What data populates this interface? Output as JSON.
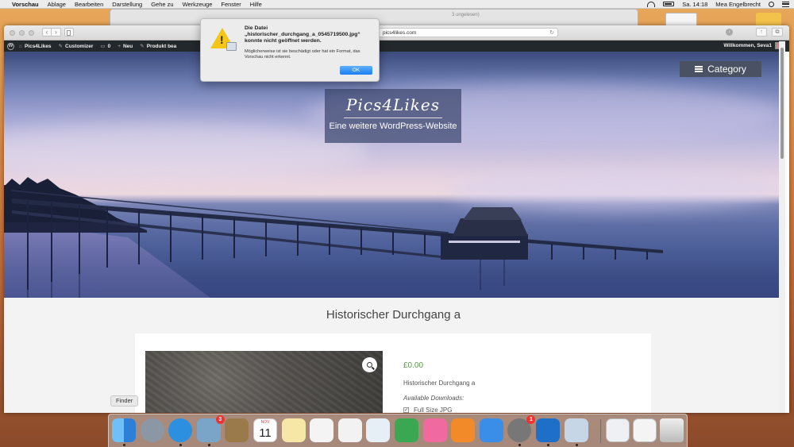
{
  "menubar": {
    "app_name": "Vorschau",
    "items": [
      "Ablage",
      "Bearbeiten",
      "Darstellung",
      "Gehe zu",
      "Werkzeuge",
      "Fenster",
      "Hilfe"
    ],
    "clock": "Sa. 14:18",
    "user": "Mea Engelbrecht"
  },
  "bg_window": {
    "title_fragment": "3 ungelesen)"
  },
  "safari": {
    "url": "pics4likes.com"
  },
  "wp_admin_bar": {
    "site_name": "Pics4Likes",
    "customizer": "Customizer",
    "comments_count": "0",
    "new_label": "Neu",
    "product_label": "Produkt bea",
    "welcome": "Willkommen, Seva1"
  },
  "hero": {
    "site_title": "Pics4Likes",
    "tagline": "Eine weitere WordPress-Website",
    "category_button": "Category"
  },
  "product": {
    "title": "Historischer Durchgang a",
    "price": "£0.00",
    "description": "Historischer Durchgang a",
    "available_downloads_label": "Available Downloads:",
    "download_option": "Full Size JPG"
  },
  "alert": {
    "title_line1": "Die Datei",
    "title_line2": "„historischer_durchgang_a_0545719500.jpg“",
    "title_line3": "konnte nicht geöffnet werden.",
    "body": "Möglicherweise ist sie beschädigt oder hat ein Format, das Vorschau nicht erkennt.",
    "ok_label": "OK"
  },
  "dock": {
    "tooltip": "Finder",
    "calendar_month": "NOV",
    "calendar_day": "11",
    "badges": {
      "photo_app": "3",
      "system_prefs": "1"
    },
    "apps": [
      {
        "name": "finder",
        "color": "#3b8ee8"
      },
      {
        "name": "launchpad",
        "color": "#8c97a6"
      },
      {
        "name": "safari",
        "color": "#2d8fe0"
      },
      {
        "name": "photo-app",
        "color": "#7aa5c9"
      },
      {
        "name": "notes-brown",
        "color": "#9a7a4a"
      },
      {
        "name": "calendar",
        "color": "#ffffff"
      },
      {
        "name": "notes",
        "color": "#f6e7a6"
      },
      {
        "name": "reminders",
        "color": "#f4f4f4"
      },
      {
        "name": "photos",
        "color": "#f2f2f2"
      },
      {
        "name": "keynote",
        "color": "#e6eef6"
      },
      {
        "name": "numbers",
        "color": "#3aa852"
      },
      {
        "name": "itunes",
        "color": "#f06aa0"
      },
      {
        "name": "ibooks",
        "color": "#f38a2a"
      },
      {
        "name": "app-store",
        "color": "#3a8ee8"
      },
      {
        "name": "system-preferences",
        "color": "#777777"
      },
      {
        "name": "mail-blue",
        "color": "#1e6fc7"
      },
      {
        "name": "preview",
        "color": "#c7d6e6"
      }
    ]
  }
}
